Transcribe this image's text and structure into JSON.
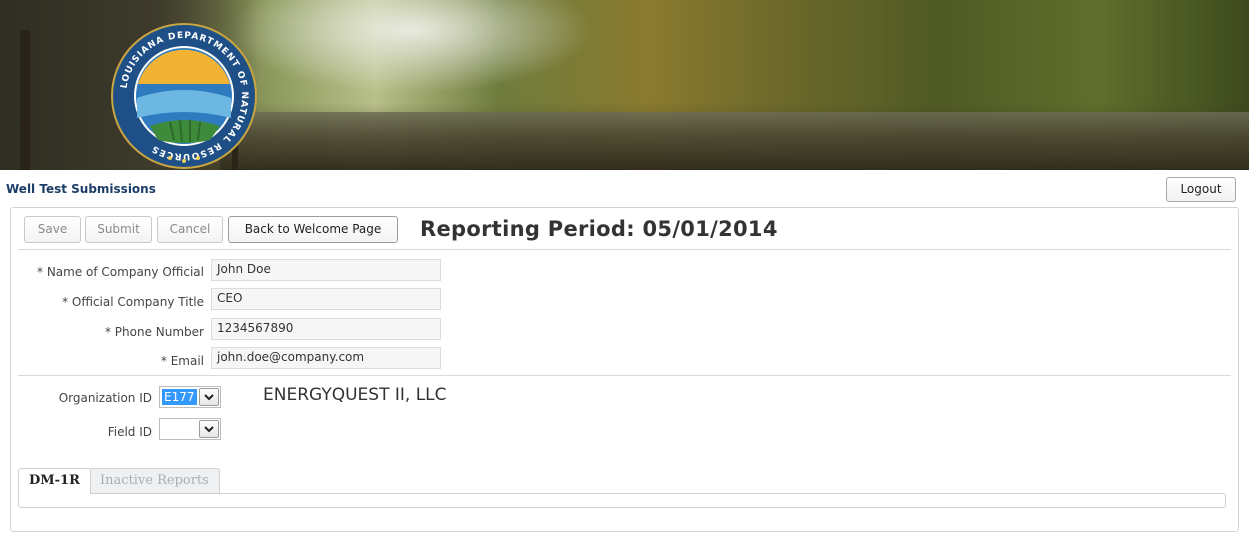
{
  "header": {
    "seal_text": "LOUISIANA DEPARTMENT OF NATURAL RESOURCES",
    "page_title": "Well Test Submissions",
    "logout_label": "Logout"
  },
  "toolbar": {
    "save_label": "Save",
    "submit_label": "Submit",
    "cancel_label": "Cancel",
    "back_label": "Back to Welcome Page",
    "reporting_period": "Reporting Period: 05/01/2014"
  },
  "contact": {
    "company_official_label": "* Name of Company Official",
    "company_official_value": "John Doe",
    "title_label": "* Official Company Title",
    "title_value": "CEO",
    "phone_label": "* Phone Number",
    "phone_value": "1234567890",
    "email_label": "* Email",
    "email_value": "john.doe@company.com"
  },
  "organization": {
    "org_id_label": "Organization ID",
    "org_id_value": "E177",
    "org_name": "ENERGYQUEST II, LLC",
    "field_id_label": "Field ID",
    "field_id_value": ""
  },
  "tabs": [
    {
      "label": "DM-1R",
      "active": true
    },
    {
      "label": "Inactive Reports",
      "active": false
    }
  ],
  "colors": {
    "title_blue": "#1c3e66",
    "selection_blue": "#3399ff"
  }
}
